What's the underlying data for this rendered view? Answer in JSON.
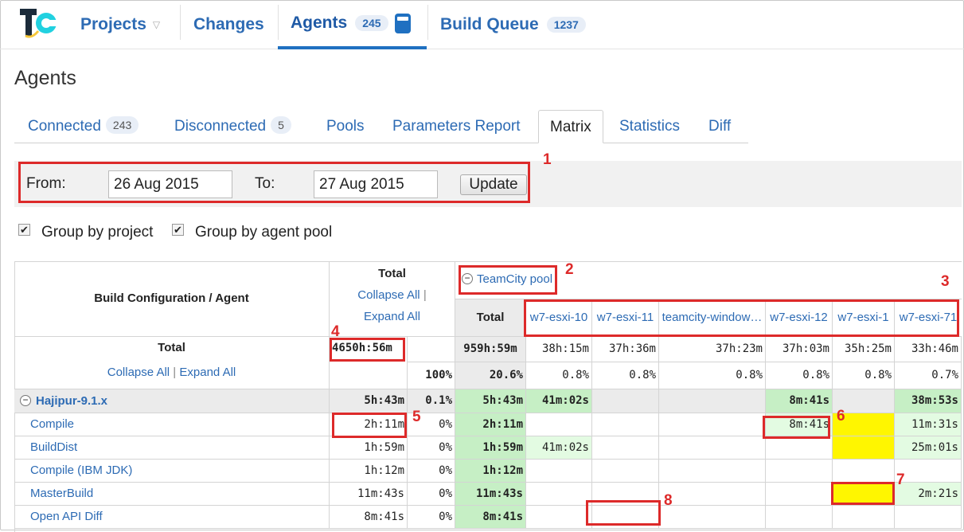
{
  "nav": {
    "logo_icon": "teamcity-logo-icon",
    "projects_label": "Projects",
    "changes_label": "Changes",
    "agents_label": "Agents",
    "agents_count": "245",
    "build_queue_label": "Build Queue",
    "build_queue_count": "1237",
    "accent": "#2d6bb4"
  },
  "page_title": "Agents",
  "subtabs": {
    "connected": "Connected",
    "connected_count": "243",
    "disconnected": "Disconnected",
    "disconnected_count": "5",
    "pools": "Pools",
    "parameters_report": "Parameters Report",
    "matrix": "Matrix",
    "statistics": "Statistics",
    "diff": "Diff"
  },
  "filter": {
    "from_label": "From:",
    "from_value": "26 Aug 2015",
    "to_label": "To:",
    "to_value": "27 Aug 2015",
    "update_label": "Update"
  },
  "options": {
    "group_by_project": "Group by project",
    "group_by_agent_pool": "Group by agent pool",
    "group_by_project_checked": true,
    "group_by_agent_pool_checked": true
  },
  "matrix": {
    "header_build_config": "Build Configuration / Agent",
    "header_total": "Total",
    "collapse_all": "Collapse All",
    "expand_all": "Expand All",
    "separator": "|",
    "pool_name": "TeamCity pool",
    "pool_total": "Total",
    "agents": [
      "w7-esxi-10",
      "w7-esxi-11",
      "teamcity-window…",
      "w7-esxi-12",
      "w7-esxi-1",
      "w7-esxi-71"
    ],
    "total_row": {
      "label": "Total",
      "grand_total": "4650h:56m",
      "grand_pct": "100%",
      "pool_total": "959h:59m",
      "pool_pct": "20.6%",
      "agent_times": [
        "38h:15m",
        "37h:36m",
        "37h:23m",
        "37h:03m",
        "35h:25m",
        "33h:46m"
      ],
      "agent_pcts": [
        "0.8%",
        "0.8%",
        "0.8%",
        "0.8%",
        "0.8%",
        "0.7%"
      ]
    },
    "project_row": {
      "name": "Hajipur-9.1.x",
      "total": "5h:43m",
      "pct": "0.1%",
      "pool_total": "5h:43m",
      "agent_times": [
        "41m:02s",
        "",
        "",
        "8m:41s",
        "",
        "38m:53s"
      ]
    },
    "config_rows": [
      {
        "name": "Compile",
        "total": "2h:11m",
        "pct": "0%",
        "pool_total": "2h:11m",
        "agent_times": [
          "",
          "",
          "",
          "8m:41s",
          "",
          "11m:31s"
        ]
      },
      {
        "name": "BuildDist",
        "total": "1h:59m",
        "pct": "0%",
        "pool_total": "1h:59m",
        "agent_times": [
          "41m:02s",
          "",
          "",
          "",
          "",
          "25m:01s"
        ]
      },
      {
        "name": "Compile (IBM JDK)",
        "total": "1h:12m",
        "pct": "0%",
        "pool_total": "1h:12m",
        "agent_times": [
          "",
          "",
          "",
          "",
          "",
          ""
        ]
      },
      {
        "name": "MasterBuild",
        "total": "11m:43s",
        "pct": "0%",
        "pool_total": "11m:43s",
        "agent_times": [
          "",
          "",
          "",
          "",
          "",
          "2m:21s"
        ]
      },
      {
        "name": "Open API Diff",
        "total": "8m:41s",
        "pct": "0%",
        "pool_total": "8m:41s",
        "agent_times": [
          "",
          "",
          "",
          "",
          "",
          ""
        ]
      }
    ]
  },
  "annotations": [
    "1",
    "2",
    "3",
    "4",
    "5",
    "6",
    "7",
    "8"
  ],
  "colors": {
    "annotation_red": "#dd2a2a",
    "cell_green": "#c6efc5",
    "cell_light_green": "#e3fbe2",
    "cell_yellow": "#fff600"
  }
}
